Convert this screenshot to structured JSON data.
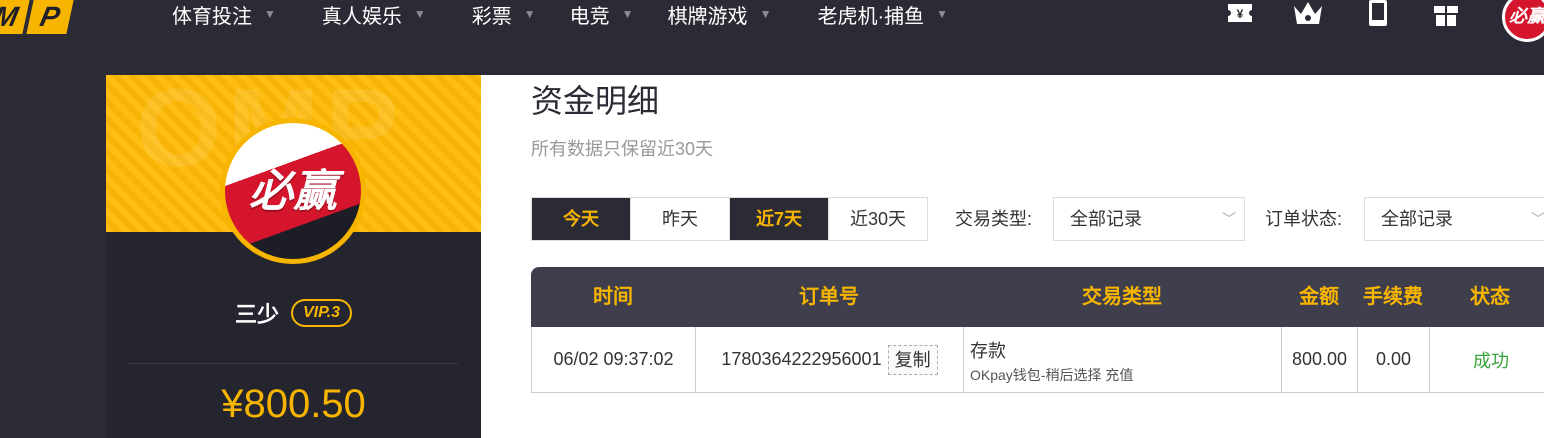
{
  "logo": {
    "letters": [
      "M",
      "P"
    ],
    "full_hint": "MP"
  },
  "nav": {
    "items": [
      {
        "label": "体育投注"
      },
      {
        "label": "真人娱乐"
      },
      {
        "label": "彩票"
      },
      {
        "label": "电竞"
      },
      {
        "label": "棋牌游戏"
      },
      {
        "label": "老虎机·捕鱼"
      }
    ],
    "icons": [
      "ticket-yen-icon",
      "crown-icon",
      "mobile-icon",
      "gift-icon"
    ],
    "avatar_text": "必赢"
  },
  "profile": {
    "avatar_brand": "必赢",
    "username": "三少",
    "vip": "VIP.3",
    "balance": "¥800.50"
  },
  "main": {
    "title": "资金明细",
    "subtitle": "所有数据只保留近30天",
    "range_tabs": [
      {
        "label": "今天",
        "active": true
      },
      {
        "label": "昨天",
        "active": false
      },
      {
        "label": "近7天",
        "active": true
      },
      {
        "label": "近30天",
        "active": false
      }
    ],
    "filters": {
      "type_label": "交易类型:",
      "type_value": "全部记录",
      "status_label": "订单状态:",
      "status_value": "全部记录"
    },
    "table": {
      "headers": [
        "时间",
        "订单号",
        "交易类型",
        "金额",
        "手续费",
        "状态"
      ],
      "rows": [
        {
          "time": "06/02 09:37:02",
          "order_no": "1780364222956001",
          "copy_label": "复制",
          "type": "存款",
          "type_detail": "OKpay钱包-稍后选择 充值",
          "amount": "800.00",
          "fee": "0.00",
          "status": "成功"
        }
      ]
    }
  },
  "colors": {
    "accent": "#f7b500",
    "dark": "#2b2b36",
    "success": "#3aa23a"
  }
}
